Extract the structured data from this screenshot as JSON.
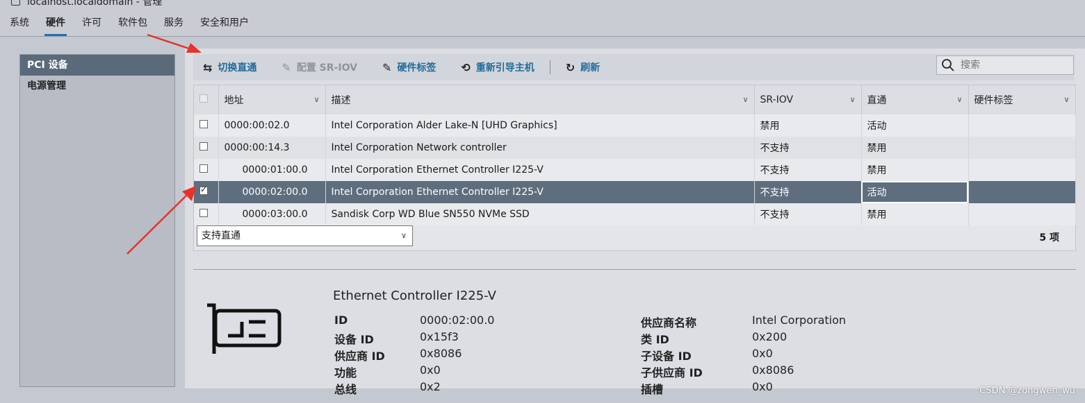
{
  "window": {
    "title": "localhost.localdomain - 管理"
  },
  "menu": [
    "系统",
    "硬件",
    "许可",
    "软件包",
    "服务",
    "安全和用户"
  ],
  "sidebar": {
    "items": [
      {
        "label": "PCI 设备"
      },
      {
        "label": "电源管理"
      }
    ]
  },
  "toolbar": {
    "toggle_passthrough": "切换直通",
    "configure_sriov": "配置 SR-IOV",
    "hardware_label": "硬件标签",
    "reboot_host": "重新引导主机",
    "refresh": "刷新",
    "search_placeholder": "搜索"
  },
  "table": {
    "columns": [
      "地址",
      "描述",
      "SR-IOV",
      "直通",
      "硬件标签"
    ],
    "rows": [
      {
        "address": "0000:00:02.0",
        "description": "Intel Corporation Alder Lake-N [UHD Graphics]",
        "sriov": "禁用",
        "passthrough": "活动",
        "label": ""
      },
      {
        "address": "0000:00:14.3",
        "description": "Intel Corporation Network controller",
        "sriov": "不支持",
        "passthrough": "禁用",
        "label": ""
      },
      {
        "address": "0000:01:00.0",
        "description": "Intel Corporation Ethernet Controller I225-V",
        "sriov": "不支持",
        "passthrough": "禁用",
        "label": ""
      },
      {
        "address": "0000:02:00.0",
        "description": "Intel Corporation Ethernet Controller I225-V",
        "sriov": "不支持",
        "passthrough": "活动",
        "label": ""
      },
      {
        "address": "0000:03:00.0",
        "description": "Sandisk Corp WD Blue SN550 NVMe SSD",
        "sriov": "不支持",
        "passthrough": "禁用",
        "label": ""
      }
    ],
    "filter_value": "支持直通",
    "count": "5 项"
  },
  "details": {
    "title": "Ethernet Controller I225-V",
    "left": [
      {
        "k": "ID",
        "v": "0000:02:00.0"
      },
      {
        "k": "设备 ID",
        "v": "0x15f3"
      },
      {
        "k": "供应商 ID",
        "v": "0x8086"
      },
      {
        "k": "功能",
        "v": "0x0"
      },
      {
        "k": "总线",
        "v": "0x2"
      }
    ],
    "right": [
      {
        "k": "供应商名称",
        "v": "Intel Corporation"
      },
      {
        "k": "类 ID",
        "v": "0x200"
      },
      {
        "k": "子设备 ID",
        "v": "0x0"
      },
      {
        "k": "子供应商 ID",
        "v": "0x8086"
      },
      {
        "k": "插槽",
        "v": "0x0"
      }
    ]
  },
  "watermark": "CSDN @zongwen_wu",
  "colors": {
    "accent": "#1f6c9c",
    "selected_row": "#5e6e7e",
    "annotation_arrow": "#e8322a"
  }
}
